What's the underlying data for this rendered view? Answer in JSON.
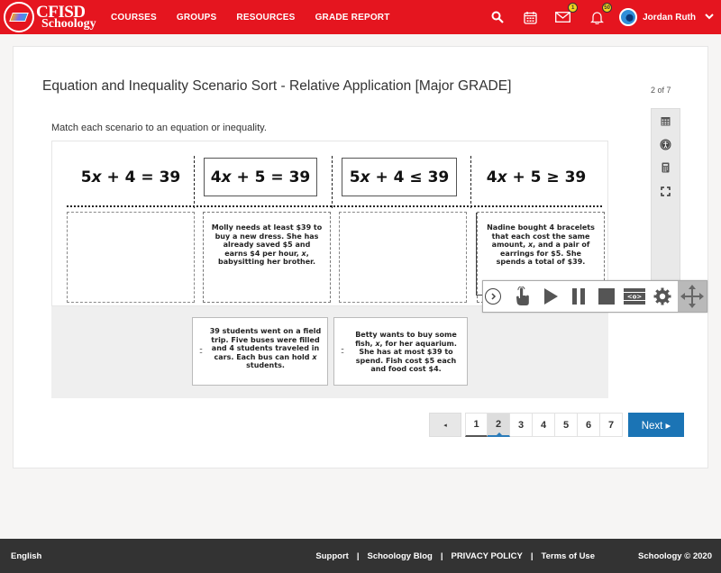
{
  "topnav": {
    "logo_line1": "CFISD",
    "logo_line2": "Schoology",
    "links": [
      "COURSES",
      "GROUPS",
      "RESOURCES",
      "GRADE REPORT"
    ],
    "messages_badge": "1",
    "notifications_badge": "50",
    "user_name": "Jordan Ruth",
    "brand_color": "#e5151f"
  },
  "assessment": {
    "title": "Equation and Inequality Scenario Sort - Relative Application [Major GRADE]",
    "page_counter": "2 of 7",
    "instruction": "Match each scenario to an equation or inequality.",
    "side_tools": [
      "calendar-icon",
      "accessibility-icon",
      "calculator-icon",
      "fullscreen-icon"
    ]
  },
  "question": {
    "categories": [
      {
        "label": "5x + 4 = 39",
        "pre": "5",
        "var": "x",
        "post": " + 4 = 39",
        "boxed": false
      },
      {
        "label": "4x + 5 = 39",
        "pre": "4",
        "var": "x",
        "post": " + 5 = 39",
        "boxed": true
      },
      {
        "label": "5x + 4 ≤ 39",
        "pre": "5",
        "var": "x",
        "post": " + 4 ≤ 39",
        "boxed": true
      },
      {
        "label": "4x + 5 ≥ 39",
        "pre": "4",
        "var": "x",
        "post": " + 5 ≥ 39",
        "boxed": false
      }
    ],
    "placed_cards": {
      "zone1": "",
      "zone2": "Molly needs at least $39 to buy a new dress.  She has already saved $5 and earns $4 per hour, x, babysitting her brother.",
      "zone3": "",
      "zone4": "Nadine bought 4 bracelets that each cost the same amount, x, and a pair of earrings for $5.  She spends a total of $39."
    },
    "bank_cards": [
      "39 students went on a field trip. Five buses were filled and 4 students traveled in cars. Each bus can hold x students.",
      "Betty wants to buy some fish, x, for her aquarium. She has at most $39 to spend.  Fish cost $5 each and food cost $4."
    ]
  },
  "float_toolbar": {
    "buttons": [
      "collapse",
      "point-and-read",
      "play",
      "pause",
      "stop",
      "screen-mask",
      "settings",
      "move"
    ]
  },
  "pagination": {
    "prev_label": "◂",
    "pages": [
      "1",
      "2",
      "3",
      "4",
      "5",
      "6",
      "7"
    ],
    "current_page": "2",
    "next_label": "Next ▸",
    "accent_color": "#1b74b5"
  },
  "footer": {
    "language": "English",
    "links": [
      "Support",
      "Schoology Blog",
      "PRIVACY POLICY",
      "Terms of Use"
    ],
    "separator": "|",
    "copyright": "Schoology © 2020"
  }
}
